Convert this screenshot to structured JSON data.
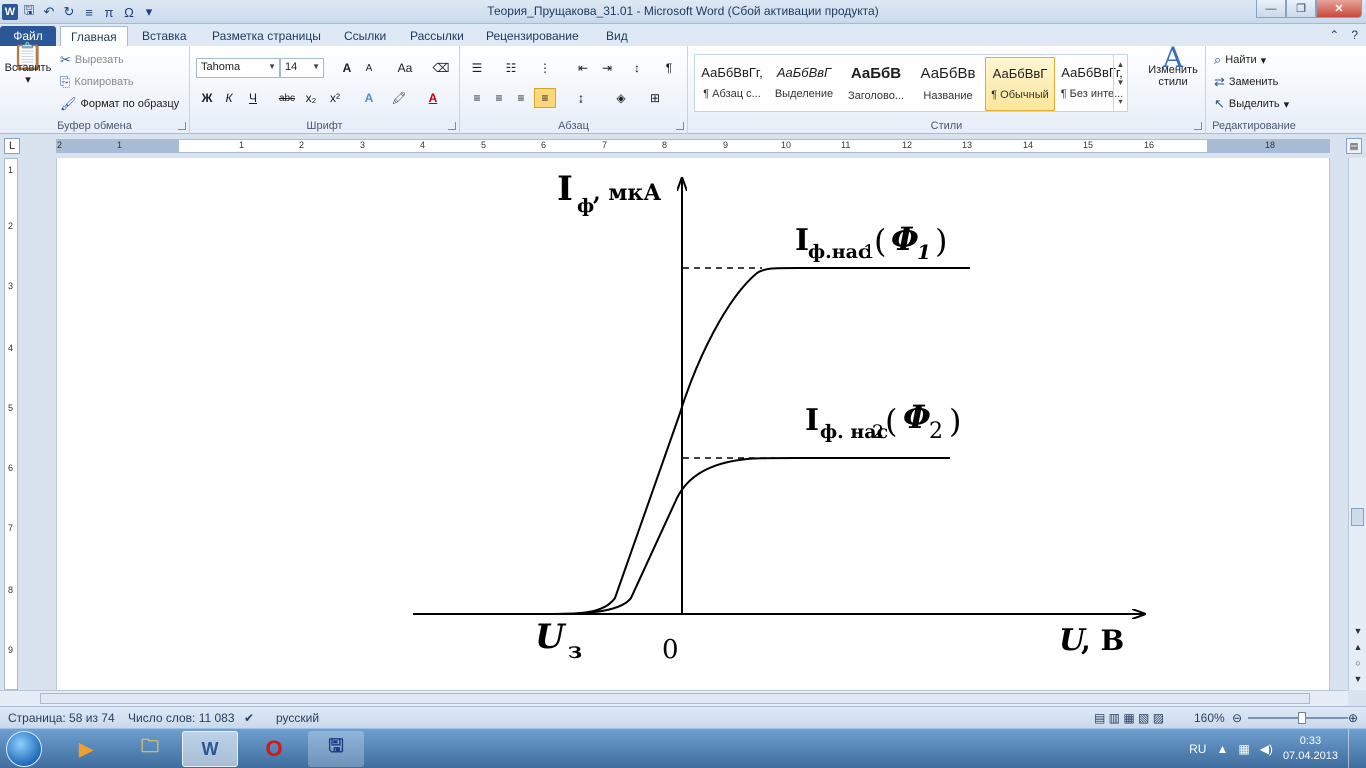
{
  "window": {
    "title": "Теория_Прущакова_31.01  -  Microsoft Word (Сбой активации продукта)"
  },
  "tabs": [
    "Файл",
    "Главная",
    "Вставка",
    "Разметка страницы",
    "Ссылки",
    "Рассылки",
    "Рецензирование",
    "Вид"
  ],
  "ribbon": {
    "clipboard": {
      "label": "Буфер обмена",
      "paste": "Вставить",
      "cut": "Вырезать",
      "copy": "Копировать",
      "format_painter": "Формат по образцу"
    },
    "font": {
      "label": "Шрифт",
      "family": "Tahoma",
      "size": "14",
      "bold": "Ж",
      "italic": "К",
      "underline": "Ч",
      "strike": "abc",
      "sub": "x₂",
      "sup": "x²",
      "grow": "A",
      "shrink": "A",
      "case": "Aa"
    },
    "paragraph": {
      "label": "Абзац",
      "pilcrow": "¶"
    },
    "styles": {
      "label": "Стили",
      "items": [
        {
          "sample": "АаБбВвГг,",
          "name": "¶ Абзац с..."
        },
        {
          "sample": "АаБбВвГ",
          "name": "Выделение"
        },
        {
          "sample": "АаБбВ",
          "name": "Заголово..."
        },
        {
          "sample": "АаБбВв",
          "name": "Название"
        },
        {
          "sample": "АаБбВвГ",
          "name": "¶ Обычный"
        },
        {
          "sample": "АаБбВвГг,",
          "name": "¶ Без инте..."
        }
      ],
      "change": "Изменить стили"
    },
    "editing": {
      "label": "Редактирование",
      "find": "Найти",
      "replace": "Заменить",
      "select": "Выделить"
    }
  },
  "ruler": {
    "numbers": [
      "2",
      "1",
      "1",
      "2",
      "3",
      "4",
      "5",
      "6",
      "7",
      "8",
      "9",
      "10",
      "11",
      "12",
      "13",
      "14",
      "15",
      "16",
      "18"
    ],
    "vnumbers": [
      "1",
      "2",
      "3",
      "4",
      "5",
      "6",
      "7",
      "8",
      "9"
    ]
  },
  "figure": {
    "y_label_main": "I",
    "y_label_sub": "ф",
    "y_label_rest": ", мкА",
    "sat1_main": "I",
    "sat1_sub": "ф.нас",
    "sat1_idx": "1",
    "sat1_phi": "Φ",
    "sat1_phi_idx": "1",
    "sat2_main": "I",
    "sat2_sub": "ф. нас",
    "sat2_idx": "2",
    "sat2_phi": "Φ",
    "sat2_phi_idx": "2",
    "u_stop_main": "U",
    "u_stop_sub": "з",
    "origin": "0",
    "x_label_main": "U",
    "x_label_rest": ", В"
  },
  "status": {
    "page": "Страница: 58 из 74",
    "words": "Число слов: 11 083",
    "lang": "русский",
    "zoom": "160%"
  },
  "taskbar": {
    "lang": "RU",
    "time": "0:33",
    "date": "07.04.2013"
  },
  "colors": {
    "file_tab": "#2b5797",
    "taskbar": "#3e6d9e"
  }
}
